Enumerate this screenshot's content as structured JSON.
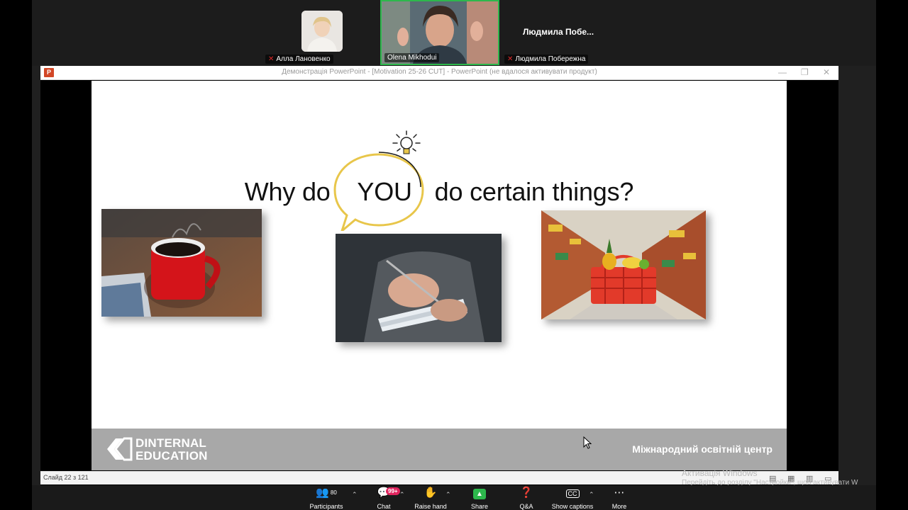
{
  "participants_gallery": [
    {
      "name": "Алла Лановенко",
      "muted": true
    },
    {
      "name": "Olena Mikhodui",
      "muted": false,
      "active_speaker": true
    },
    {
      "name": "Людмила Побережна",
      "muted": true,
      "display_name_truncated": "Людмила  Побе..."
    }
  ],
  "powerpoint": {
    "window_title": "Демонстрація PowerPoint - [Motivation 25-26 CUT] - PowerPoint (не вдалося активувати продукт)",
    "app_icon": "P",
    "slide": {
      "title_before": "Why do",
      "title_highlight": "YOU",
      "title_after": "do certain things?",
      "images": [
        {
          "name": "coffee-cup-photo"
        },
        {
          "name": "writing-notes-photo"
        },
        {
          "name": "grocery-basket-photo"
        }
      ],
      "footer": {
        "logo_line1": "DINTERNAL",
        "logo_line2": "EDUCATION",
        "center_label": "Міжнародний освітній центр"
      }
    },
    "status_bar": {
      "slide_counter": "Слайд 22 з 121"
    },
    "watermark": {
      "line1": "Активація Windows",
      "line2": "Перейдіть до розділу \"Настройки\", щоб активувати W"
    }
  },
  "toolbar": {
    "participants": {
      "label": "Participants",
      "count": "80"
    },
    "chat": {
      "label": "Chat",
      "badge": "99+"
    },
    "raise_hand": {
      "label": "Raise hand"
    },
    "share": {
      "label": "Share"
    },
    "qa": {
      "label": "Q&A"
    },
    "captions": {
      "label": "Show captions"
    },
    "more": {
      "label": "More"
    }
  },
  "colors": {
    "active_speaker_border": "#2db84c",
    "mute_icon": "#e02828",
    "chat_badge": "#e0245e",
    "share_button": "#2db84c",
    "slide_footer": "#a8a8a8",
    "bubble_outline": "#e8c64a"
  }
}
